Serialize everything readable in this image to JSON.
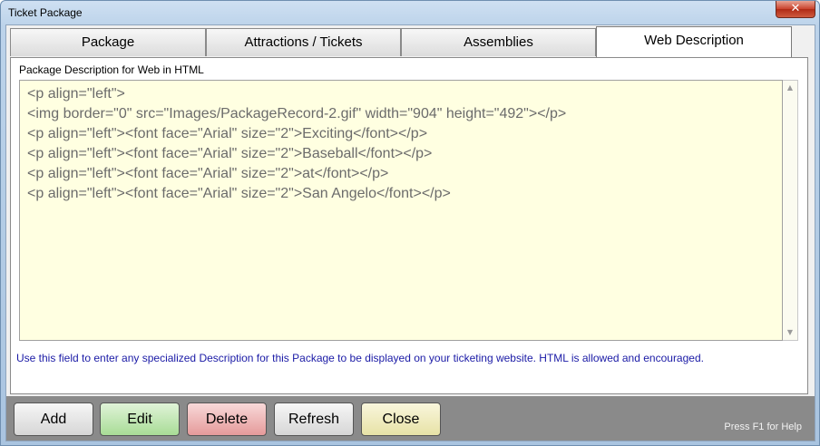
{
  "window": {
    "title": "Ticket Package",
    "close_glyph": "✕"
  },
  "tabs": [
    {
      "label": "Package",
      "active": false
    },
    {
      "label": "Attractions / Tickets",
      "active": false
    },
    {
      "label": "Assemblies",
      "active": false
    },
    {
      "label": "Web Description",
      "active": true
    }
  ],
  "web_description": {
    "field_label": "Package Description for Web in HTML",
    "html_value": "<p align=\"left\">\n<img border=\"0\" src=\"Images/PackageRecord-2.gif\" width=\"904\" height=\"492\"></p>\n<p align=\"left\"><font face=\"Arial\" size=\"2\">Exciting</font></p>\n<p align=\"left\"><font face=\"Arial\" size=\"2\">Baseball</font></p>\n<p align=\"left\"><font face=\"Arial\" size=\"2\">at</font></p>\n<p align=\"left\"><font face=\"Arial\" size=\"2\">San Angelo</font></p>",
    "hint": "Use this field to enter any specialized Description for this Package to be displayed on your ticketing website.  HTML is allowed and encouraged."
  },
  "buttons": {
    "add": "Add",
    "edit": "Edit",
    "delete": "Delete",
    "refresh": "Refresh",
    "close": "Close"
  },
  "status": {
    "help_text": "Press F1 for Help"
  },
  "icons": {
    "scroll_up": "▲",
    "scroll_down": "▼"
  }
}
